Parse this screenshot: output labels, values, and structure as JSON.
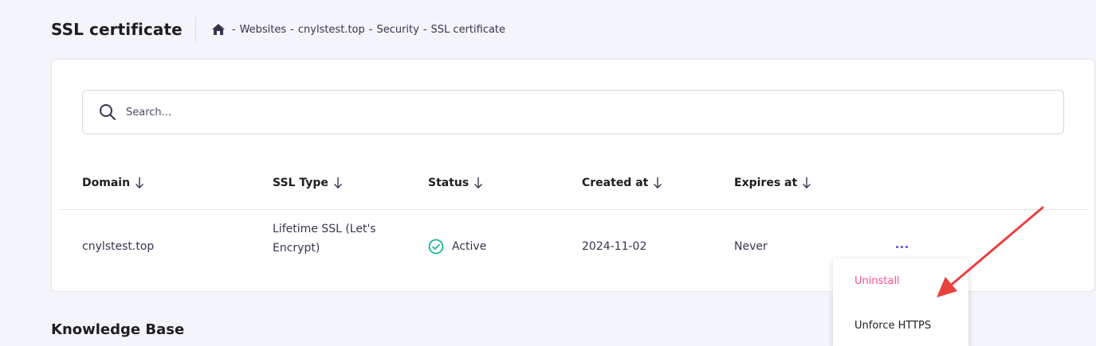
{
  "header": {
    "title": "SSL certificate",
    "breadcrumb": [
      "Websites",
      "cnylstest.top",
      "Security",
      "SSL certificate"
    ],
    "separator": "-"
  },
  "search": {
    "placeholder": "Search..."
  },
  "table": {
    "columns": [
      {
        "label": "Domain",
        "sort_icon": "arrow-down-icon"
      },
      {
        "label": "SSL Type",
        "sort_icon": "arrow-down-icon"
      },
      {
        "label": "Status",
        "sort_icon": "arrow-down-icon"
      },
      {
        "label": "Created at",
        "sort_icon": "arrow-down-icon"
      },
      {
        "label": "Expires at",
        "sort_icon": "arrow-down-icon"
      }
    ],
    "rows": [
      {
        "domain": "cnylstest.top",
        "ssl_type_line1": "Lifetime SSL (Let's",
        "ssl_type_line2": "Encrypt)",
        "status": "Active",
        "status_icon": "check-circle-icon",
        "created_at": "2024-11-02",
        "expires_at": "Never",
        "actions_icon": "more-horizontal-icon"
      }
    ]
  },
  "dropdown": {
    "items": [
      "Uninstall",
      "Unforce HTTPS"
    ]
  },
  "knowledge_base": {
    "title": "Knowledge Base"
  },
  "colors": {
    "accent": "#673de6",
    "success": "#00b090",
    "danger": "#fc5185",
    "annotation": "#e8423f"
  }
}
